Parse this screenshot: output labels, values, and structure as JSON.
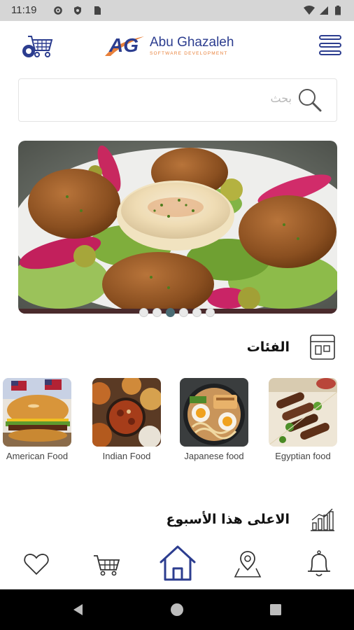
{
  "status_bar": {
    "time": "11:19"
  },
  "header": {
    "logo_title": "Abu Ghazaleh",
    "logo_subtitle": "SOFTWARE DEVELOPMENT",
    "logo_mark": "AG"
  },
  "search": {
    "placeholder": "بحث"
  },
  "banner": {
    "slide_count": 6,
    "active_index": 2
  },
  "categories_section": {
    "title": "الفئات",
    "items": [
      {
        "label": "American Food"
      },
      {
        "label": "Indian Food"
      },
      {
        "label": "Japanese food"
      },
      {
        "label": "Egyptian food"
      }
    ]
  },
  "top_week_section": {
    "title": "الاعلى هذا الأسبوع"
  },
  "bottom_nav": {
    "items": [
      "heart-icon",
      "cart-icon",
      "home-icon",
      "location-icon",
      "bell-icon"
    ],
    "active": "home-icon"
  },
  "colors": {
    "brand_blue": "#2c3d8f",
    "brand_orange": "#e8803a",
    "nav_active": "#2c3d8f",
    "dot_active": "#4a6c74"
  }
}
